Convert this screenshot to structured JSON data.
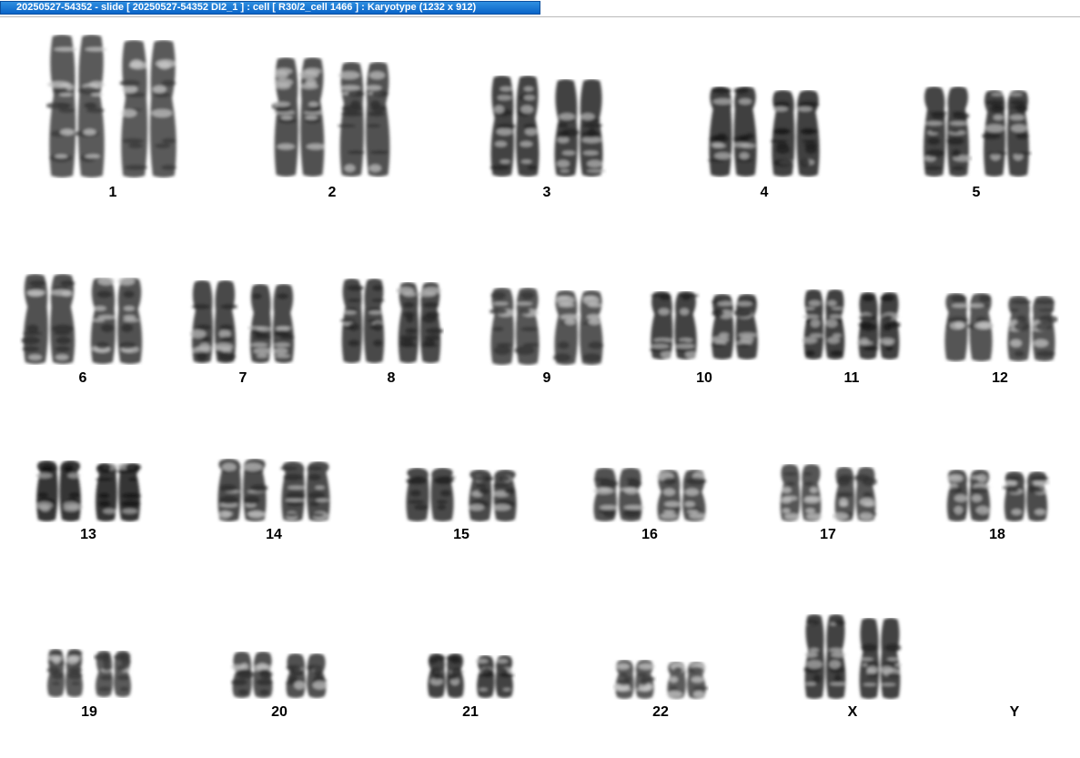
{
  "window": {
    "title": "20250527-54352 - slide [ 20250527-54352 DI2_1 ] : cell [ R30/2_cell 1466 ] : Karyotype  (1232 x 912)"
  },
  "karyotype": {
    "pairs": [
      {
        "label": "1",
        "count": 2
      },
      {
        "label": "2",
        "count": 2
      },
      {
        "label": "3",
        "count": 2
      },
      {
        "label": "4",
        "count": 2
      },
      {
        "label": "5",
        "count": 2
      },
      {
        "label": "6",
        "count": 2
      },
      {
        "label": "7",
        "count": 2
      },
      {
        "label": "8",
        "count": 2
      },
      {
        "label": "9",
        "count": 2
      },
      {
        "label": "10",
        "count": 2
      },
      {
        "label": "11",
        "count": 2
      },
      {
        "label": "12",
        "count": 2
      },
      {
        "label": "13",
        "count": 2
      },
      {
        "label": "14",
        "count": 2
      },
      {
        "label": "15",
        "count": 2
      },
      {
        "label": "16",
        "count": 2
      },
      {
        "label": "17",
        "count": 2
      },
      {
        "label": "18",
        "count": 2
      },
      {
        "label": "19",
        "count": 2
      },
      {
        "label": "20",
        "count": 2
      },
      {
        "label": "21",
        "count": 2
      },
      {
        "label": "22",
        "count": 2
      },
      {
        "label": "X",
        "count": 2
      },
      {
        "label": "Y",
        "count": 0
      }
    ]
  }
}
